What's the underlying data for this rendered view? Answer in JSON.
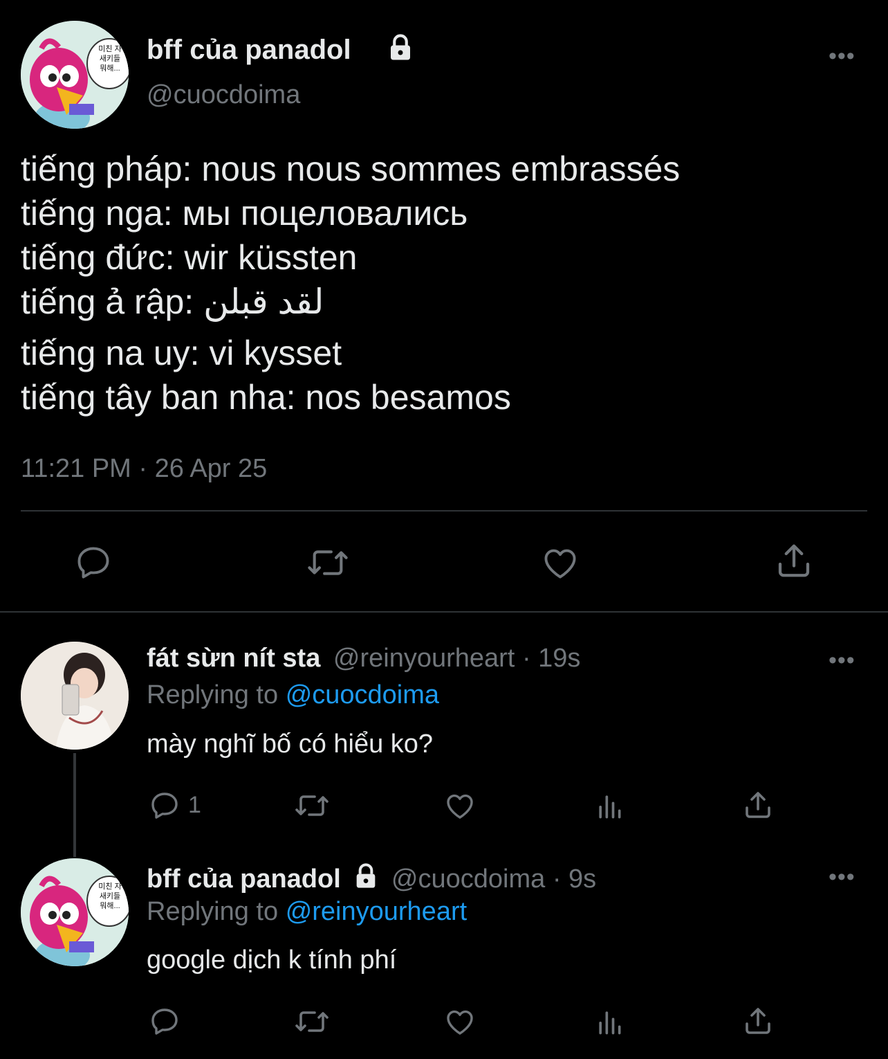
{
  "main_tweet": {
    "display_name": "bff của panadol",
    "handle": "@cuocdoima",
    "avatar_caption": [
      "미친 자",
      "새키들",
      "뭐해..."
    ],
    "lines": [
      "tiếng pháp: nous nous sommes embrassés",
      "tiếng nga: мы поцеловались",
      "tiếng đức: wir küssten",
      "tiếng ả rập: لقد قبلن",
      "tiếng na uy: vi kysset",
      "tiếng tây ban nha: nos besamos"
    ],
    "timestamp": "11:21 PM · 26 Apr 25"
  },
  "replies": [
    {
      "display_name": "fát sừn nít sta",
      "handle": "@reinyourheart",
      "time": "· 19s",
      "replying_label": "Replying to",
      "replying_to": "@cuocdoima",
      "text": "mày nghĩ bố có hiểu ko?",
      "reply_count": "1"
    },
    {
      "display_name": "bff của panadol",
      "handle": "@cuocdoima",
      "time": "· 9s",
      "replying_label": "Replying to",
      "replying_to": "@reinyourheart",
      "text": "google dịch k tính phí",
      "reply_count": ""
    }
  ],
  "more_label": "•••",
  "icons": {
    "lock": "lock-icon",
    "reply": "reply-icon",
    "retweet": "retweet-icon",
    "like": "heart-icon",
    "share": "share-icon",
    "views": "views-icon",
    "more": "more-icon"
  },
  "colors": {
    "background": "#000000",
    "text": "#e7e9ea",
    "muted": "#71767b",
    "link": "#1d9bf0",
    "divider": "#2f3336"
  }
}
